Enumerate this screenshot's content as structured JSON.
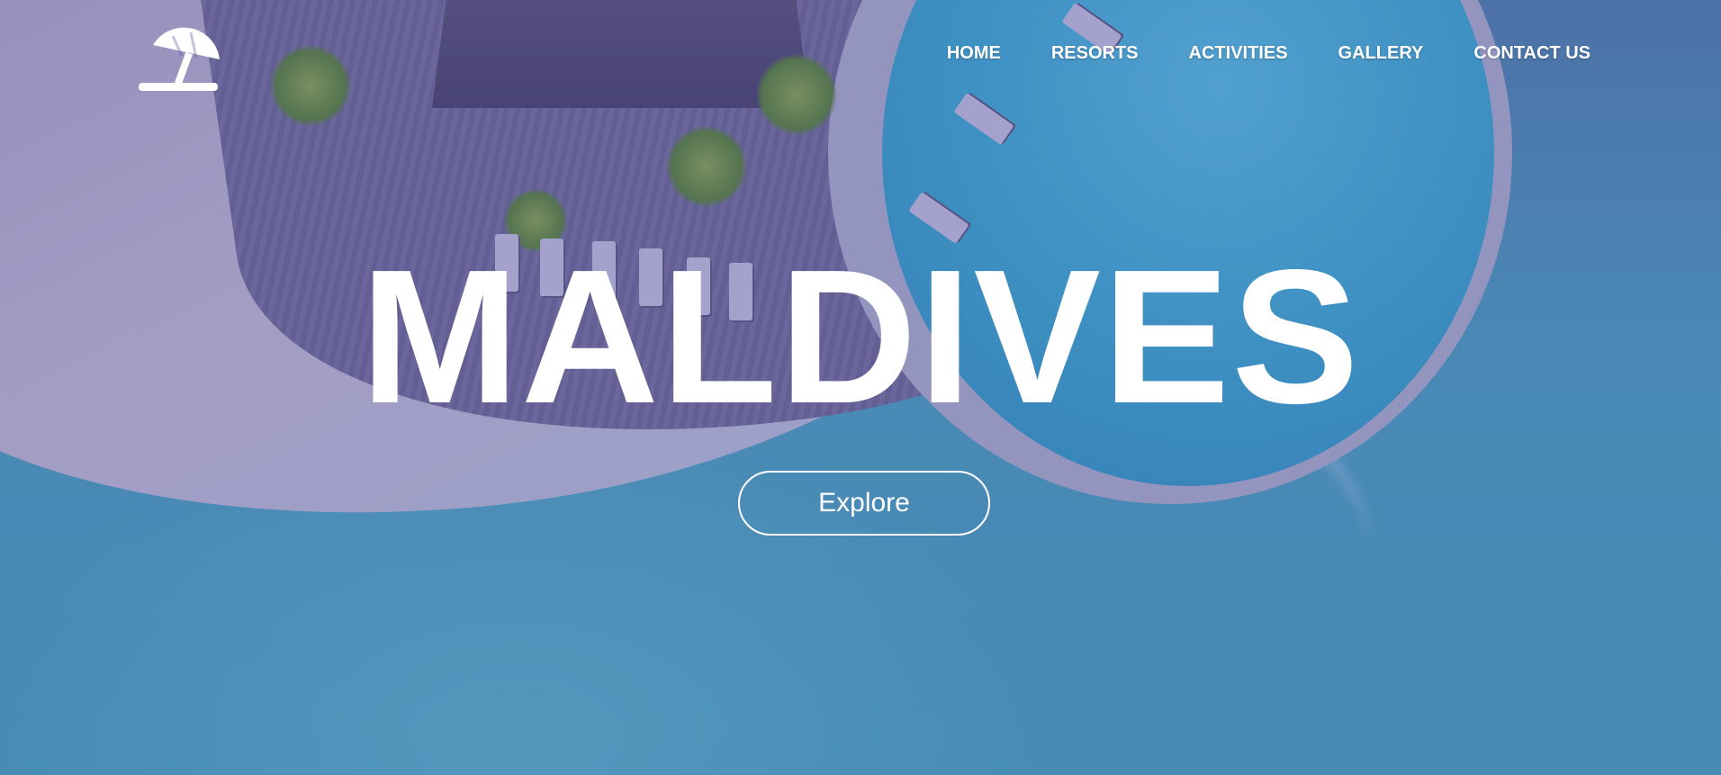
{
  "header": {
    "logo_icon": "beach-umbrella-icon",
    "nav": [
      {
        "label": "HOME"
      },
      {
        "label": "RESORTS"
      },
      {
        "label": "ACTIVITIES"
      },
      {
        "label": "GALLERY"
      },
      {
        "label": "CONTACT US"
      }
    ]
  },
  "hero": {
    "title": "MALDIVES",
    "cta_label": "Explore"
  },
  "colors": {
    "text": "#ffffff",
    "overlay": "#463caa",
    "water": "#46aab8"
  }
}
